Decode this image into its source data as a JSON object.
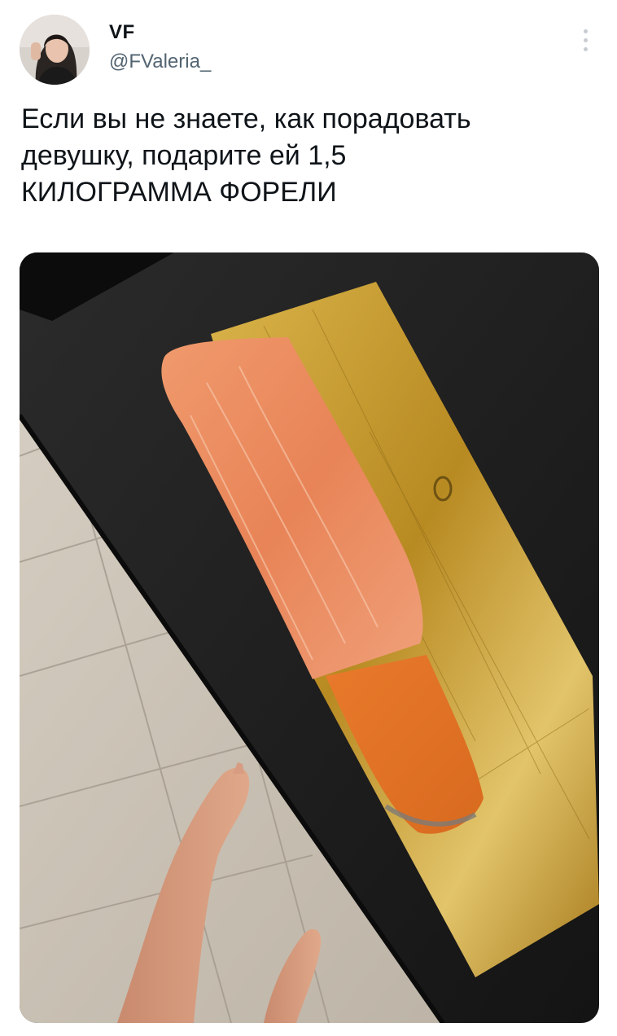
{
  "tweet": {
    "author": {
      "display_name": "VF",
      "handle": "@FValeria_",
      "avatar_icon": "user-avatar-photo"
    },
    "more_icon": "more-vertical-icon",
    "text": "Если вы не знаете, как порадовать\nдевушку, подарите ей 1,5\nКИЛОГРАММА ФОРЕЛИ",
    "media": {
      "type": "photo",
      "icon": "photo-trout-fillet"
    }
  },
  "colors": {
    "text_primary": "#0f1419",
    "text_secondary": "#536471",
    "gold_foil": "#c9a23a",
    "fish": "#e8875a"
  }
}
